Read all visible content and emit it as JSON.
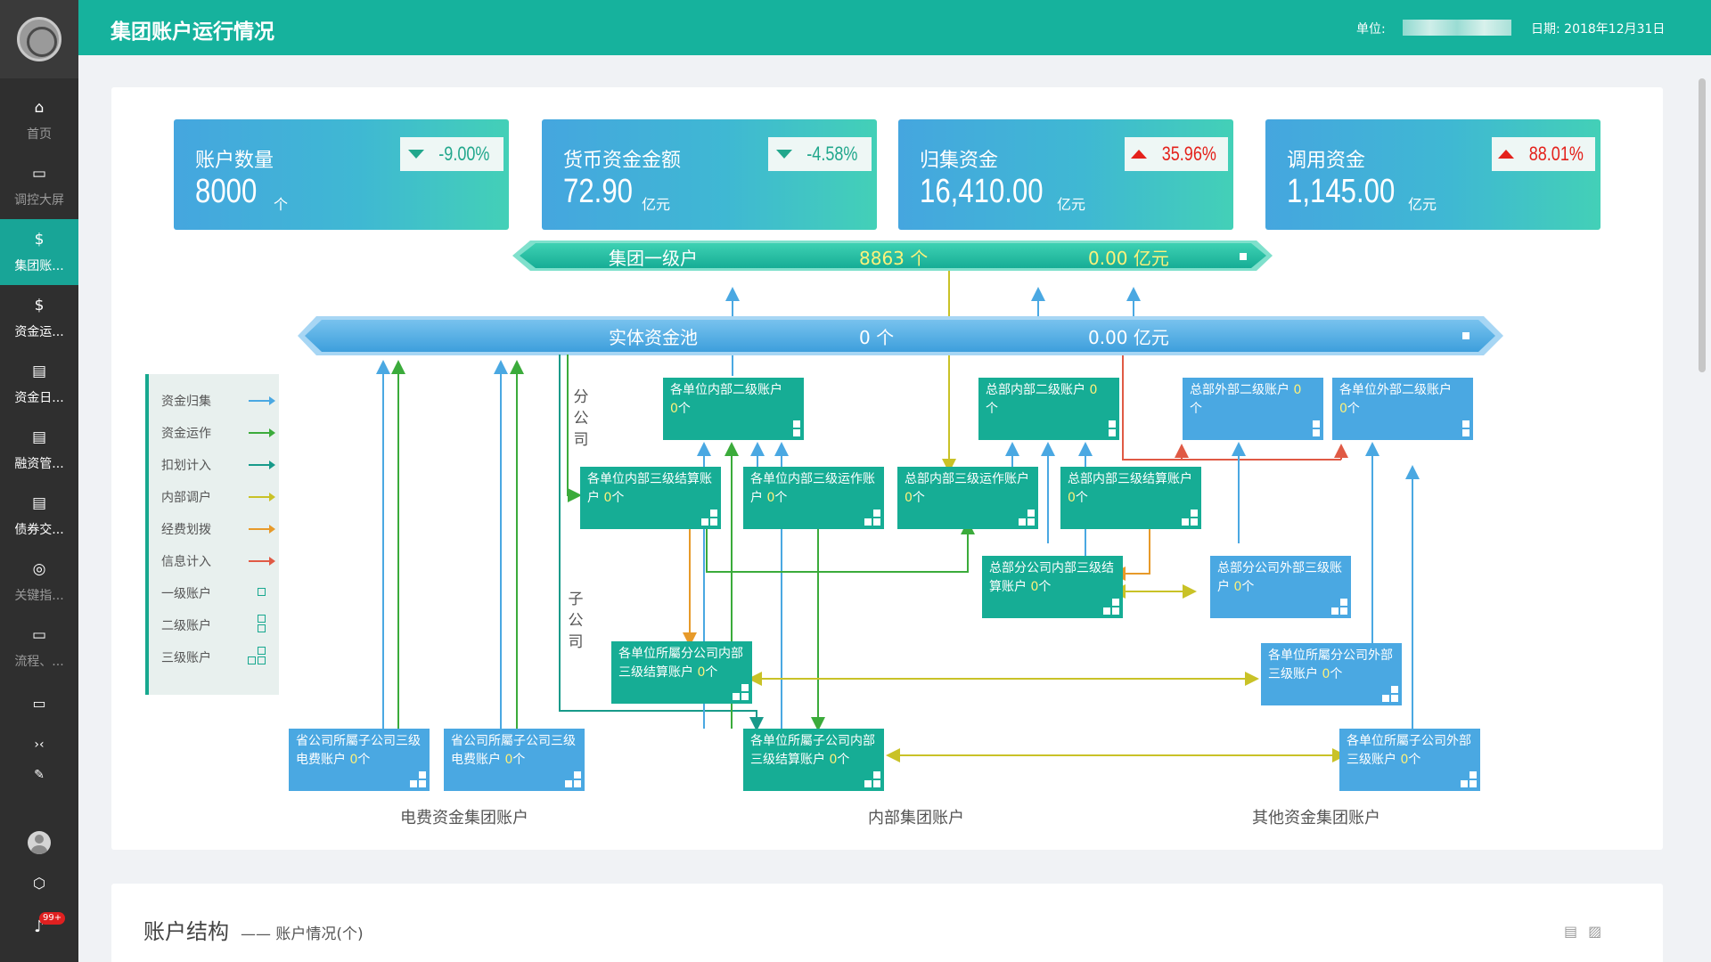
{
  "app": {
    "title": "集团账户运行情况",
    "unit_label": "单位:",
    "date_label": "日期:",
    "date_value": "2018年12月31日"
  },
  "sidebar": {
    "items": [
      {
        "label": "首页",
        "icon": "home-icon",
        "glyph": "⌂"
      },
      {
        "label": "调控大屏",
        "icon": "folder-icon",
        "glyph": "▭"
      },
      {
        "label": "集团账...",
        "icon": "account-icon",
        "glyph": "$"
      },
      {
        "label": "资金运...",
        "icon": "fund-icon",
        "glyph": "$"
      },
      {
        "label": "资金日...",
        "icon": "journal-icon",
        "glyph": "▤"
      },
      {
        "label": "融资管...",
        "icon": "finance-icon",
        "glyph": "▤"
      },
      {
        "label": "债券交...",
        "icon": "bond-icon",
        "glyph": "▤"
      },
      {
        "label": "关键指...",
        "icon": "gauge-icon",
        "glyph": "◎"
      },
      {
        "label": "流程、...",
        "icon": "folder-icon",
        "glyph": "▭"
      }
    ],
    "extra_folder_glyph": "▭",
    "collapse_glyph": "›‹",
    "pin_glyph": "✎",
    "box_glyph": "⬡",
    "bell_glyph": "♪",
    "notification_count": "99+"
  },
  "kpis": [
    {
      "title": "账户数量",
      "value": "8000",
      "unit": "个",
      "change": "-9.00%",
      "direction": "down"
    },
    {
      "title": "货币资金金额",
      "value": "72.90",
      "unit": "亿元",
      "change": "-4.58%",
      "direction": "down"
    },
    {
      "title": "归集资金",
      "value": "16,410.00",
      "unit": "亿元",
      "change": "35.96%",
      "direction": "up"
    },
    {
      "title": "调用资金",
      "value": "1,145.00",
      "unit": "亿元",
      "change": "88.01%",
      "direction": "up"
    }
  ],
  "banners": {
    "top": {
      "name": "集团一级户",
      "count": "8863 个",
      "amount": "0.00 亿元"
    },
    "pool": {
      "name": "实体资金池",
      "count": "0 个",
      "amount": "0.00 亿元"
    }
  },
  "legend": [
    {
      "label": "资金归集",
      "color": "#4aa8e2"
    },
    {
      "label": "资金运作",
      "color": "#3bab3b"
    },
    {
      "label": "扣划计入",
      "color": "#179a8a"
    },
    {
      "label": "内部调户",
      "color": "#c9c227"
    },
    {
      "label": "经费划拨",
      "color": "#e79a2a"
    },
    {
      "label": "信息计入",
      "color": "#e05a45"
    },
    {
      "label": "一级账户"
    },
    {
      "label": "二级账户"
    },
    {
      "label": "三级账户"
    }
  ],
  "vertical_labels": {
    "branch": "分公司",
    "subsidiary": "子公司"
  },
  "boxes": [
    {
      "id": "unit-internal-2",
      "text": "各单位内部二级账户",
      "count": "0",
      "unit": "个"
    },
    {
      "id": "hq-internal-2",
      "text": "总部内部二级账户",
      "count": "0",
      "unit": "个"
    },
    {
      "id": "hq-external-2",
      "text": "总部外部二级账户",
      "count": "0",
      "unit": "个"
    },
    {
      "id": "unit-external-2",
      "text": "各单位外部二级账户",
      "count": "0",
      "unit": "个"
    },
    {
      "id": "unit-internal-3-settle",
      "text": "各单位内部三级结算账户",
      "count": "0",
      "unit": "个"
    },
    {
      "id": "unit-internal-3-op",
      "text": "各单位内部三级运作账户",
      "count": "0",
      "unit": "个"
    },
    {
      "id": "hq-internal-3-op",
      "text": "总部内部三级运作账户",
      "count": "0",
      "unit": "个"
    },
    {
      "id": "hq-internal-3-settle",
      "text": "总部内部三级结算账户",
      "count": "0",
      "unit": "个"
    },
    {
      "id": "hq-branch-internal-3",
      "text": "总部分公司内部三级结算账户",
      "count": "0",
      "unit": "个"
    },
    {
      "id": "hq-branch-external-3",
      "text": "总部分公司外部三级账户",
      "count": "0",
      "unit": "个"
    },
    {
      "id": "unit-branch-internal-3",
      "text": "各单位所屬分公司内部三级结算账户",
      "count": "0",
      "unit": "个"
    },
    {
      "id": "unit-branch-external-3",
      "text": "各单位所屬分公司外部三级账户",
      "count": "0",
      "unit": "个"
    },
    {
      "id": "prov-sub-elec-1",
      "text": "省公司所屬子公司三级电费账户",
      "count": "0",
      "unit": "个"
    },
    {
      "id": "prov-sub-elec-2",
      "text": "省公司所屬子公司三级电费账户",
      "count": "0",
      "unit": "个"
    },
    {
      "id": "unit-sub-internal-3",
      "text": "各单位所屬子公司内部三级结算账户",
      "count": "0",
      "unit": "个"
    },
    {
      "id": "unit-sub-external-3",
      "text": "各单位所屬子公司外部三级账户",
      "count": "0",
      "unit": "个"
    }
  ],
  "groups": [
    "电费资金集团账户",
    "内部集团账户",
    "其他资金集团账户"
  ],
  "section2": {
    "title": "账户结构",
    "subtitle": "—— 账户情况(个)"
  }
}
